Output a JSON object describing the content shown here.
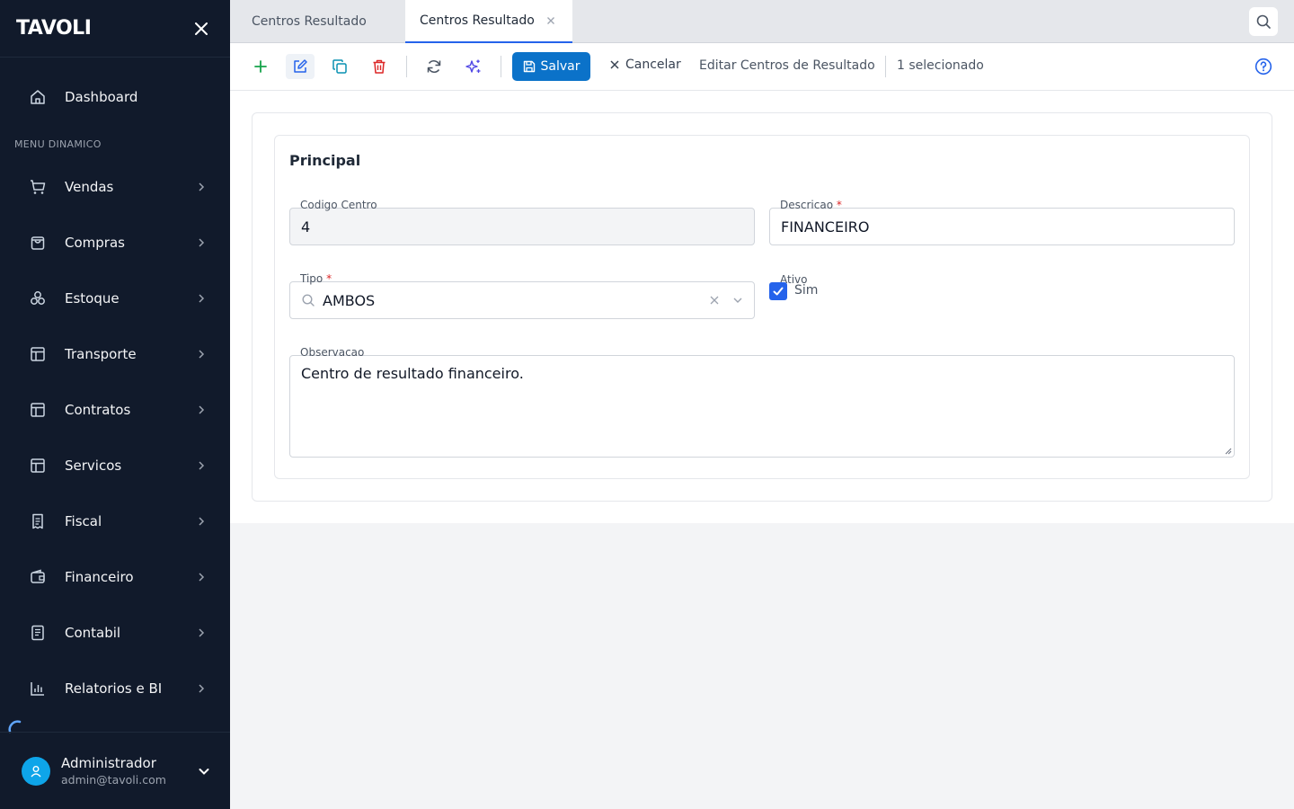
{
  "sidebar": {
    "logo": "TAVOLI",
    "dashboard": "Dashboard",
    "section_label": "MENU DINAMICO",
    "items": [
      {
        "label": "Vendas",
        "icon": "cart-icon"
      },
      {
        "label": "Compras",
        "icon": "bag-icon"
      },
      {
        "label": "Estoque",
        "icon": "boxes-icon"
      },
      {
        "label": "Transporte",
        "icon": "layout-icon"
      },
      {
        "label": "Contratos",
        "icon": "layout-icon"
      },
      {
        "label": "Servicos",
        "icon": "layout-icon"
      },
      {
        "label": "Fiscal",
        "icon": "receipt-icon"
      },
      {
        "label": "Financeiro",
        "icon": "wallet-icon"
      },
      {
        "label": "Contabil",
        "icon": "book-icon"
      },
      {
        "label": "Relatorios e BI",
        "icon": "bar-chart-icon"
      }
    ],
    "user": {
      "name": "Administrador",
      "email": "admin@tavoli.com"
    }
  },
  "tabs": [
    {
      "label": "Centros Resultado"
    },
    {
      "label": "Centros Resultado"
    }
  ],
  "toolbar": {
    "save_label": "Salvar",
    "cancel_label": "Cancelar",
    "title": "Editar Centros de Resultado",
    "selected": "1 selecionado"
  },
  "form": {
    "section_title": "Principal",
    "codigo": {
      "label": "Codigo Centro",
      "value": "4"
    },
    "descricao": {
      "label": "Descricao",
      "required": "*",
      "value": "FINANCEIRO"
    },
    "tipo": {
      "label": "Tipo",
      "required": "*",
      "value": "AMBOS"
    },
    "ativo": {
      "label": "Ativo",
      "checked": true,
      "text": "Sim"
    },
    "observacao": {
      "label": "Observacao",
      "value": "Centro de resultado financeiro."
    }
  },
  "colors": {
    "sidebar_bg": "#111a2b",
    "primary": "#0b72c9",
    "add": "#16a34a",
    "delete": "#dc2626",
    "ai": "#4f46e5",
    "required": "#dc2626"
  }
}
